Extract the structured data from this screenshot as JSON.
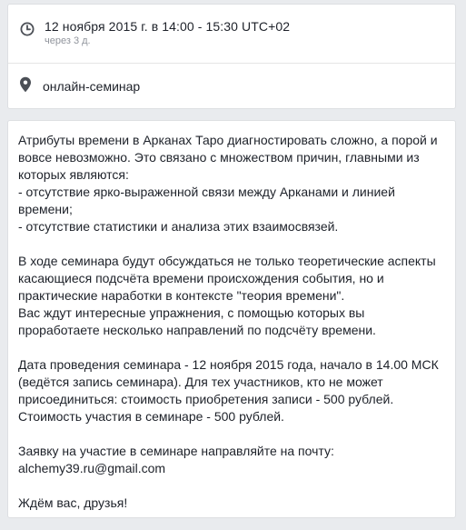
{
  "event": {
    "datetime": "12 ноября 2015 г. в 14:00 - 15:30 UTC+02",
    "relative": "через 3 д.",
    "location": "онлайн-семинар"
  },
  "description": {
    "p1": [
      "Атрибуты времени в Арканах Таро диагностировать сложно, а порой и вовсе невозможно. Это связано с множеством причин, главными из которых являются:",
      "- отсутствие ярко-выраженной связи между Арканами и линией времени;",
      "- отсутствие статистики и анализа этих взаимосвязей."
    ],
    "p2": [
      "В ходе семинара будут обсуждаться не только теоретические аспекты касающиеся подсчёта времени происхождения события, но и практические наработки в контексте \"теория времени\".",
      "Вас ждут интересные упражнения, с помощью которых вы проработаете несколько направлений по подсчёту времени."
    ],
    "p3": [
      "Дата проведения семинара - 12 ноября 2015 года, начало в 14.00 МСК (ведётся запись семинара). Для тех участников, кто не может присоединиться: стоимость приобретения записи - 500 рублей.",
      "Стоимость участия в семинаре - 500 рублей."
    ],
    "p4": [
      "Заявку на участие в семинаре направляйте на почту:",
      "alchemy39.ru@gmail.com"
    ],
    "p5": [
      "Ждём вас, друзья!"
    ]
  },
  "colors": {
    "background": "#e9ebee",
    "card": "#ffffff",
    "text": "#1d2129",
    "secondary_text": "#90949c",
    "icon": "#4b4f56"
  }
}
